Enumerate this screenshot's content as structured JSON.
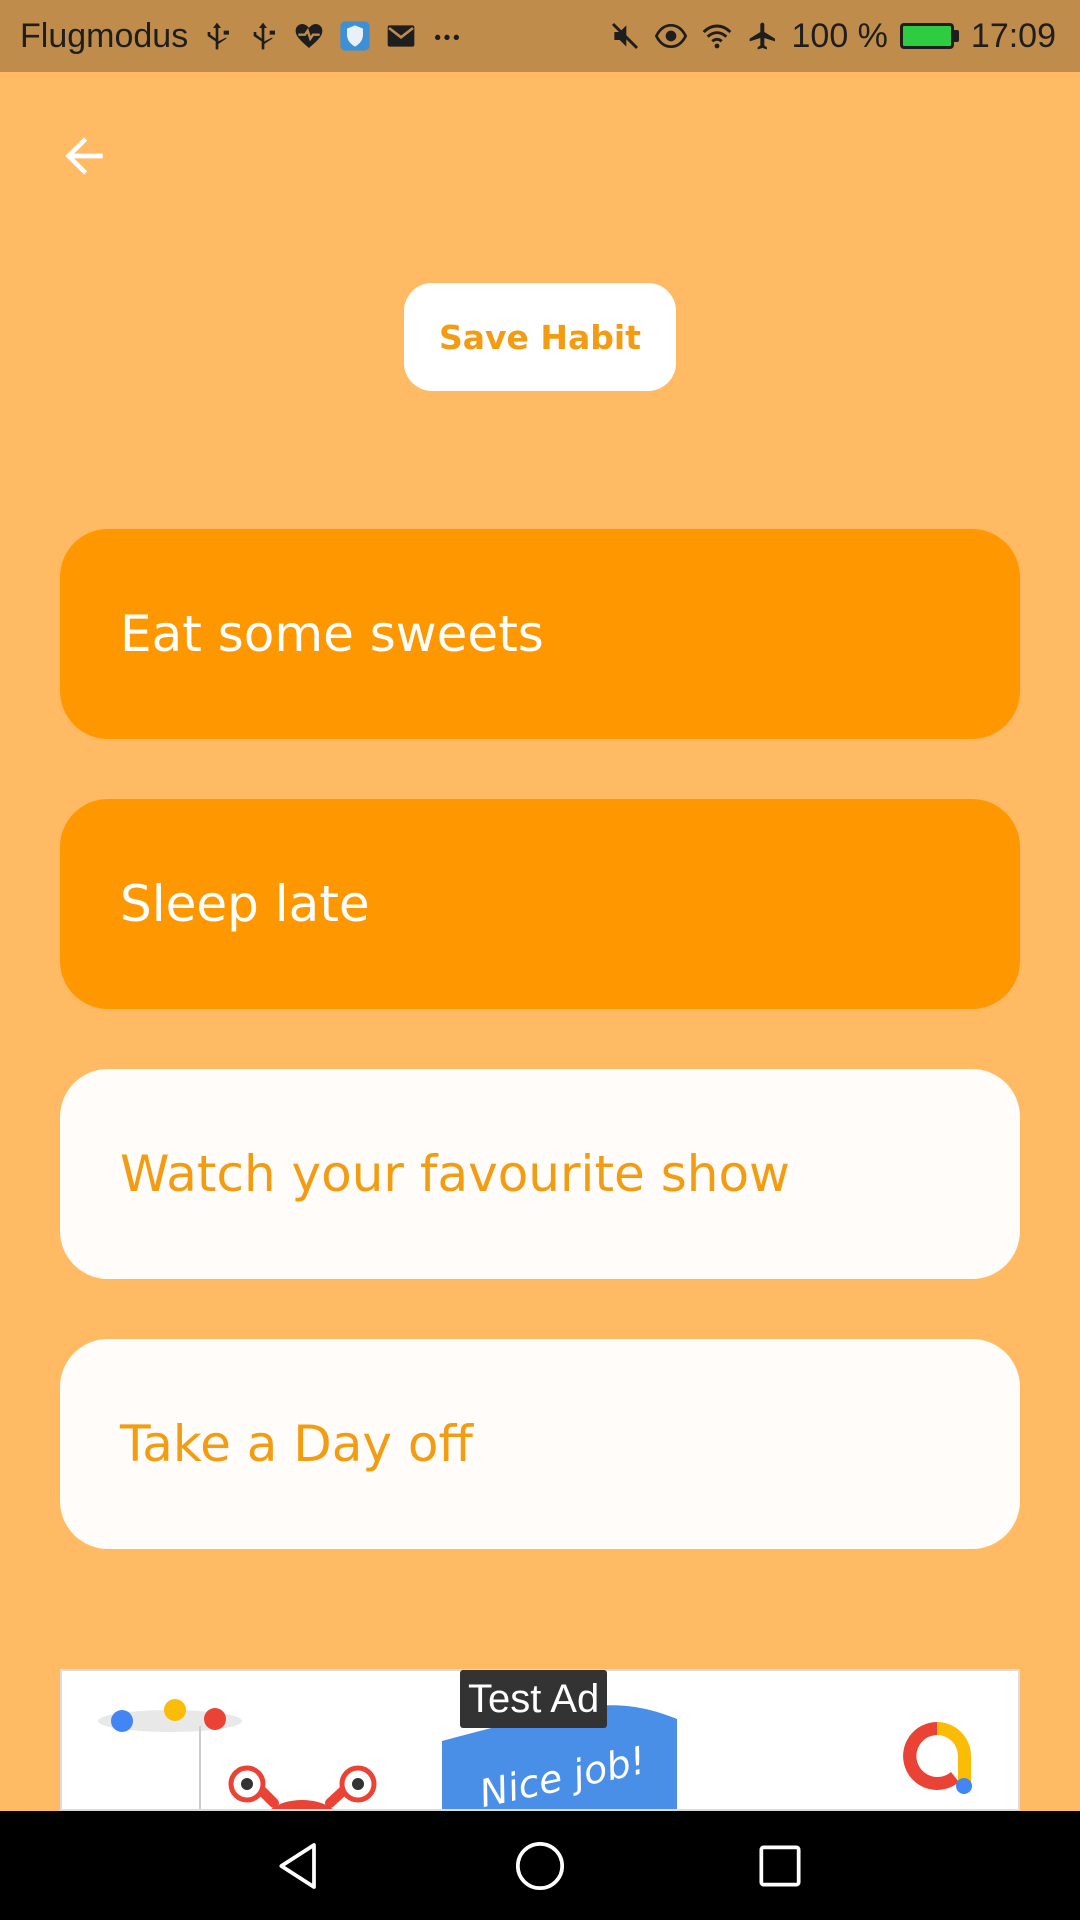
{
  "status_bar": {
    "left_label": "Flugmodus",
    "battery_percent": "100 %",
    "time": "17:09",
    "left_icons": [
      "usb-icon",
      "usb-icon",
      "heart-rate-icon",
      "shield-icon",
      "mail-icon",
      "more-icon"
    ],
    "right_icons": [
      "mute-icon",
      "eye-icon",
      "wifi-icon",
      "airplane-icon",
      "battery-icon"
    ],
    "battery_level": 1.0
  },
  "toolbar": {
    "back_icon": "arrow-left-icon",
    "save_label": "Save Habit"
  },
  "habits": [
    {
      "label": "Eat some sweets",
      "selected": true
    },
    {
      "label": "Sleep late",
      "selected": true
    },
    {
      "label": "Watch your favourite show",
      "selected": false
    },
    {
      "label": "Take a Day off",
      "selected": false
    }
  ],
  "ad": {
    "label": "Test Ad",
    "banner_text": "Nice job!"
  },
  "nav_bar": {
    "icons": [
      "back-triangle-icon",
      "home-circle-icon",
      "recents-square-icon"
    ]
  },
  "colors": {
    "background": "#FFBA63",
    "status_bar": "#C08C4B",
    "selected_card": "#FF9800",
    "unselected_card": "#FFFCF9",
    "accent_text": "#F39C12"
  }
}
